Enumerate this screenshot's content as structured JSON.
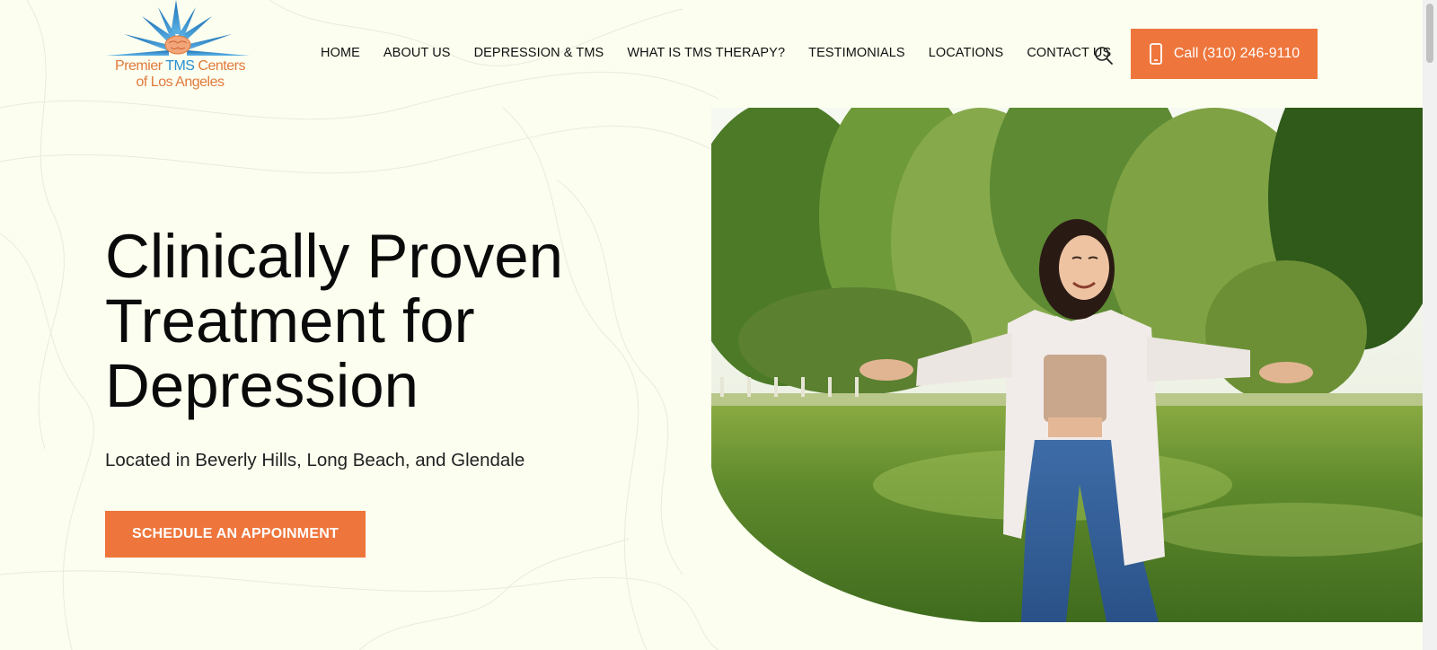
{
  "logo": {
    "line1_part1": "Premier ",
    "line1_tms": "TMS",
    "line1_part2": " Centers",
    "line2": "of Los Angeles",
    "icon": "starburst-brain-icon"
  },
  "nav": {
    "items": [
      {
        "label": "HOME"
      },
      {
        "label": "ABOUT US"
      },
      {
        "label": "DEPRESSION & TMS"
      },
      {
        "label": "WHAT IS TMS THERAPY?"
      },
      {
        "label": "TESTIMONIALS"
      },
      {
        "label": "LOCATIONS"
      },
      {
        "label": "CONTACT US"
      }
    ],
    "search_icon": "search-icon"
  },
  "call": {
    "label": "Call (310) 246-9110",
    "icon": "phone-icon"
  },
  "hero": {
    "title_line1": "Clinically Proven",
    "title_line2": "Treatment for",
    "title_line3": "Depression",
    "subtitle": "Located in Beverly Hills, Long Beach, and Glendale",
    "cta_label": "SCHEDULE AN APPOINMENT"
  },
  "colors": {
    "accent": "#ee763c",
    "background": "#fcfeef",
    "logo_blue": "#2a8fd0",
    "logo_orange": "#e07a3c"
  }
}
